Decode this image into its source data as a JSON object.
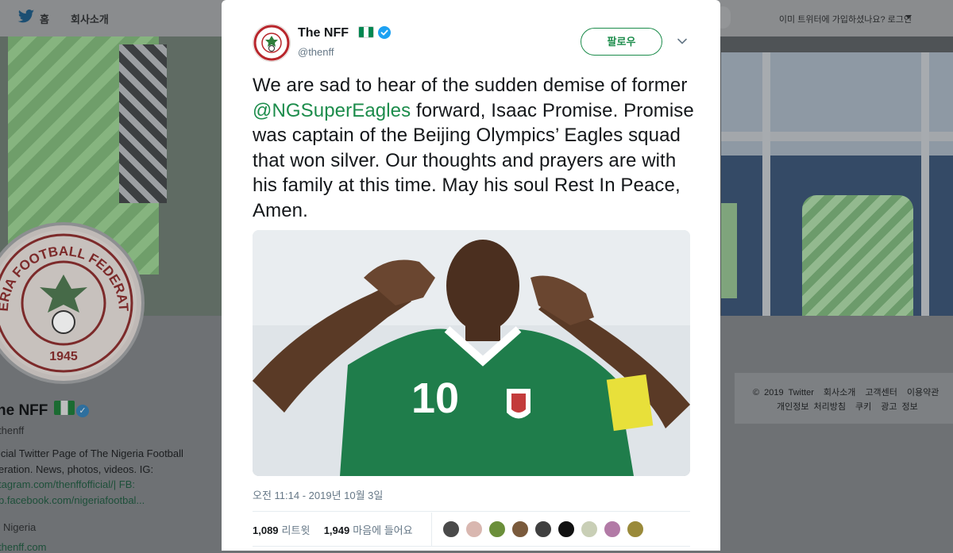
{
  "topbar": {
    "home_label": "홈",
    "about_label": "회사소개",
    "signin_prompt": "이미 트위터에 가입하셨나요? 로그인"
  },
  "profile": {
    "logo_text": "NIGERIA FOOTBALL FEDERATION",
    "logo_year": "1945",
    "name": "he NFF",
    "verified_icon": "verified-badge-icon",
    "handle": "thenff",
    "bio_line1": "icial Twitter Page of The Nigeria Football",
    "bio_line2": "eration. News, photos, videos. IG:",
    "bio_line3": "tagram.com/thenffofficial/| FB:",
    "bio_line4": "b.facebook.com/nigeriafootbal...",
    "location": "Nigeria",
    "url": "thenff.com"
  },
  "footer": {
    "links": [
      "© 2019 Twitter",
      "회사소개",
      "고객센터",
      "이용약관",
      "개인정보 처리방침",
      "쿠키",
      "광고 정보"
    ]
  },
  "tweet": {
    "display_name": "The NFF",
    "handle": "@thenff",
    "follow_label": "팔로우",
    "text_part1": "We are sad to hear of the sudden demise of former ",
    "mention": "@NGSuperEagles",
    "text_part2": " forward, Isaac Promise. Promise was captain of the Beijing Olympics’ Eagles squad that won silver. Our thoughts and prayers are with his family at this time. May his soul Rest In Peace, Amen.",
    "photo_jersey_number": "10",
    "timestamp": "오전 11:14 - 2019년 10월 3일",
    "retweet_count": "1,089",
    "retweet_label": "리트윗",
    "like_count": "1,949",
    "like_label": "마음에 들어요",
    "colors": {
      "accent": "#1c8c4b",
      "muted": "#657786",
      "text": "#14171a"
    }
  }
}
